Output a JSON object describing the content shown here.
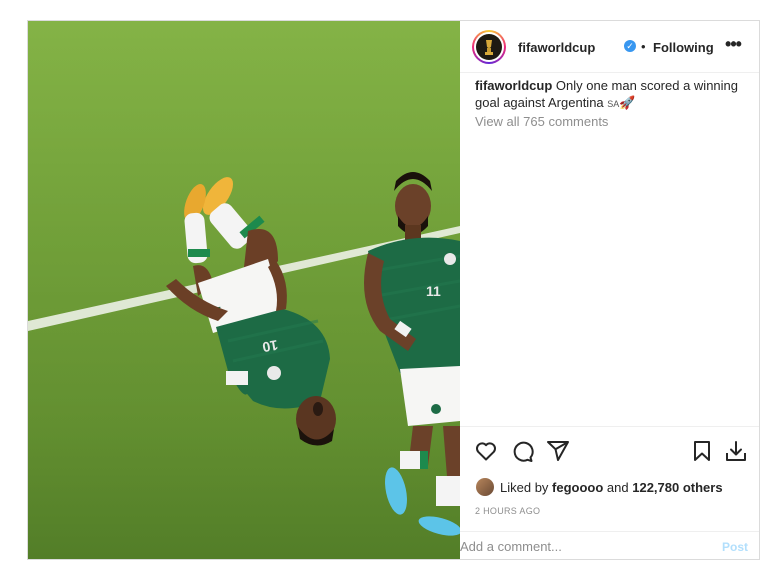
{
  "post": {
    "username": "fifaworldcup",
    "verified_icon": "verified-badge-icon",
    "separator": "•",
    "follow_status": "Following",
    "more_icon": "more-options-icon",
    "more_glyph": "•••",
    "caption_username": "fifaworldcup",
    "caption_text": "Only one man scored a winning goal against Argentina",
    "caption_flag": "SA",
    "caption_emoji": "🚀",
    "view_comments": "View all 765 comments",
    "liked_prefix": "Liked by ",
    "liked_user": "fegoooo",
    "liked_mid": " and ",
    "liked_count": "122,780 others",
    "timestamp": "2 HOURS AGO",
    "comment_placeholder": "Add a comment...",
    "post_label": "Post",
    "actions": [
      "heart-icon",
      "comment-icon",
      "share-icon",
      "bookmark-icon",
      "download-icon"
    ],
    "colors": {
      "accent_blue": "#3897f0",
      "post_button_disabled": "#b2dffc",
      "muted_text": "#8e8e8e",
      "kit_green": "#1d6b45",
      "pitch_green": "#77a83c"
    }
  }
}
